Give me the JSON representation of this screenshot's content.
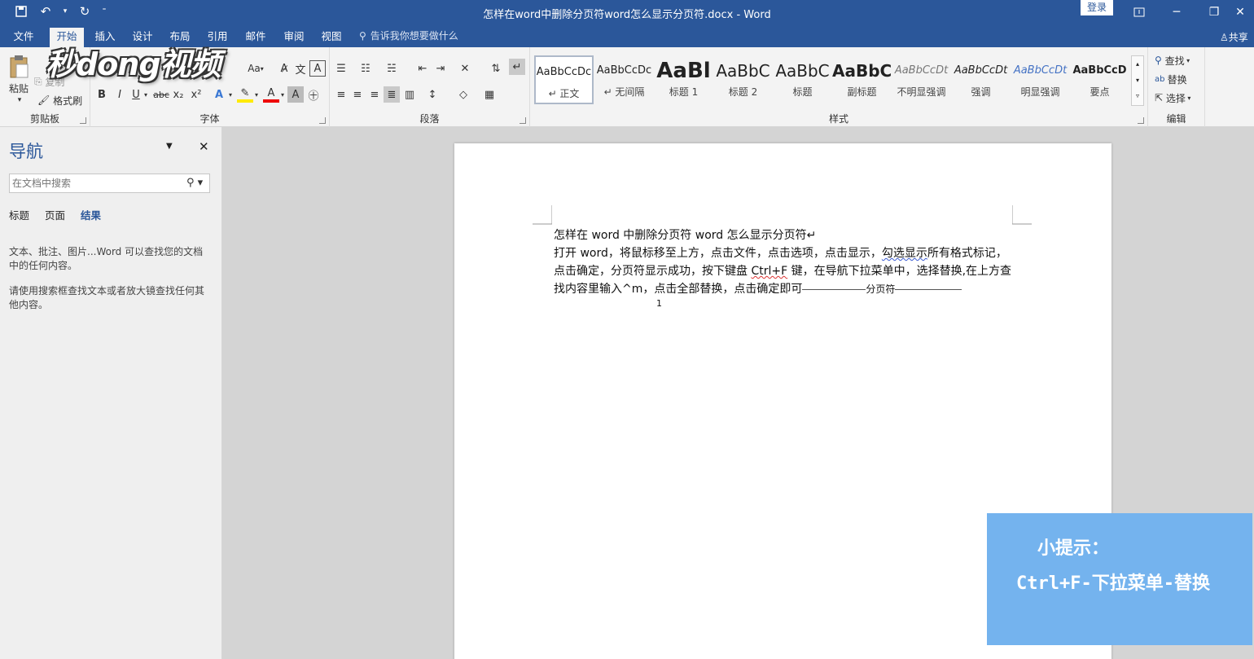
{
  "window": {
    "title": "怎样在word中删除分页符word怎么显示分页符.docx - Word",
    "login_label": "登录"
  },
  "tabs": [
    {
      "label": "文件"
    },
    {
      "label": "开始"
    },
    {
      "label": "插入"
    },
    {
      "label": "设计"
    },
    {
      "label": "布局"
    },
    {
      "label": "引用"
    },
    {
      "label": "邮件"
    },
    {
      "label": "审阅"
    },
    {
      "label": "视图"
    }
  ],
  "tellme": "告诉我你想要做什么",
  "share": "共享",
  "ribbon": {
    "clipboard": {
      "label": "剪贴板",
      "paste": "粘贴",
      "copy": "复制",
      "format_painter": "格式刷"
    },
    "font": {
      "label": "字体",
      "font_size_label": "Aa"
    },
    "paragraph": {
      "label": "段落"
    },
    "styles": {
      "label": "样式",
      "items": [
        {
          "sample": "AaBbCcDc",
          "name": "↵ 正文"
        },
        {
          "sample": "AaBbCcDc",
          "name": "↵ 无间隔"
        },
        {
          "sample": "AaBl",
          "name": "标题 1"
        },
        {
          "sample": "AaBbC",
          "name": "标题 2"
        },
        {
          "sample": "AaBbC",
          "name": "标题"
        },
        {
          "sample": "AaBbC",
          "name": "副标题"
        },
        {
          "sample": "AaBbCcDt",
          "name": "不明显强调"
        },
        {
          "sample": "AaBbCcDt",
          "name": "强调"
        },
        {
          "sample": "AaBbCcDt",
          "name": "明显强调"
        },
        {
          "sample": "AaBbCcD",
          "name": "要点"
        }
      ]
    },
    "editing": {
      "label": "编辑",
      "find": "查找",
      "replace": "替换",
      "select": "选择"
    }
  },
  "watermark": "秒dong视频",
  "nav": {
    "title": "导航",
    "search_placeholder": "在文档中搜索",
    "tabs": [
      "标题",
      "页面",
      "结果"
    ],
    "message1": "文本、批注、图片...Word 可以查找您的文档中的任何内容。",
    "message2": "请使用搜索框查找文本或者放大镜查找任何其他内容。"
  },
  "document": {
    "line1": "怎样在 word 中删除分页符 word 怎么显示分页符↵",
    "line2a": "打开 word，将鼠标移至上方，点击文件，点击选项，点击显示，",
    "line2b": "勾选显示",
    "line2c": "所有格式标记，",
    "line3a": "点击确定，分页符显示成功，按下键盘 ",
    "line3b": "Ctrl+F",
    "line3c": " 键，在导航下拉菜单中，选择替换,在上方查",
    "line4": "找内容里输入^m，点击全部替换，点击确定即可",
    "page_break_label": "分页符",
    "cursor_mark": "1"
  },
  "tip": {
    "title": "小提示：",
    "body": "Ctrl+F-下拉菜单-替换"
  }
}
